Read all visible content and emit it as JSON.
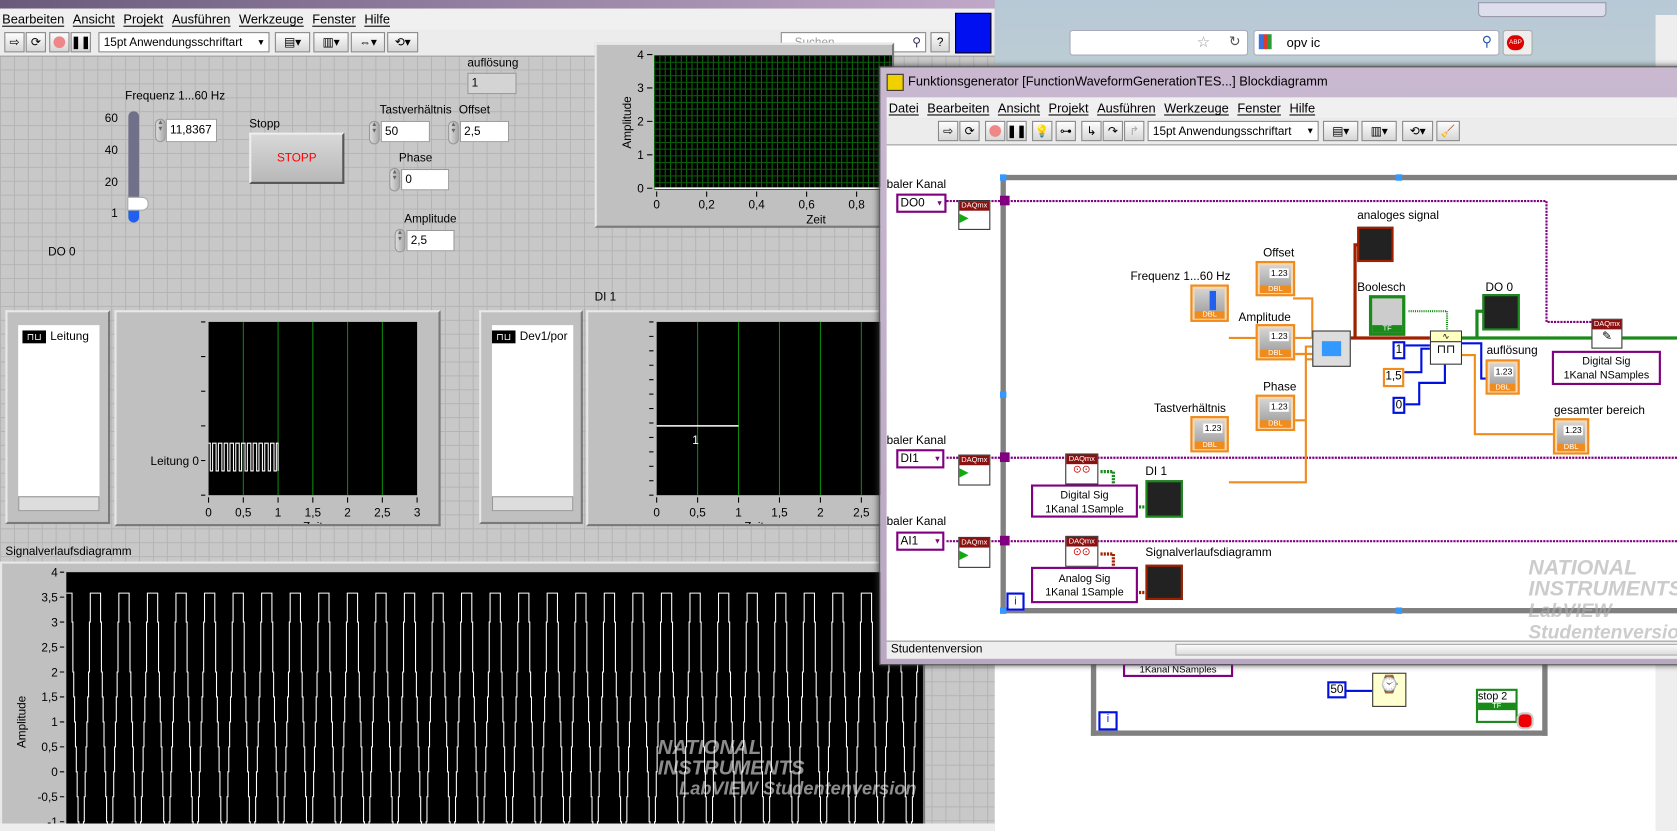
{
  "front_panel": {
    "menu": [
      "Bearbeiten",
      "Ansicht",
      "Projekt",
      "Ausführen",
      "Werkzeuge",
      "Fenster",
      "Hilfe"
    ],
    "font_select": "15pt Anwendungsschriftart",
    "search_placeholder": "Suchen",
    "help_glyph": "?",
    "aufloesung": {
      "label": "auflösung",
      "value": "1"
    },
    "frequenz": {
      "label": "Frequenz 1...60 Hz",
      "value": "11,8367",
      "scale": [
        "60",
        "40",
        "20",
        "1"
      ],
      "slider_value": 11.8367,
      "min": 1,
      "max": 60
    },
    "stopp": {
      "label": "Stopp",
      "button": "STOPP"
    },
    "tastverhaeltnis": {
      "label": "Tastverhältnis",
      "value": "50"
    },
    "offset": {
      "label": "Offset",
      "value": "2,5"
    },
    "phase": {
      "label": "Phase",
      "value": "0"
    },
    "amplitude": {
      "label": "Amplitude",
      "value": "2,5"
    },
    "do0_label": "DO 0",
    "do0_legend": "Leitung",
    "di1_label": "DI 1",
    "di1_legend": "Dev1/por",
    "waveform_label": "Signalverlaufsdiagramm"
  },
  "chart_data": [
    {
      "name": "analoges signal",
      "type": "line",
      "xlabel": "Zeit",
      "ylabel": "Amplitude",
      "xticks": [
        "0",
        "0,2",
        "0,4",
        "0,6",
        "0,8"
      ],
      "yticks": [
        "0",
        "1",
        "2",
        "3",
        "4"
      ],
      "xlim": [
        0,
        0.95
      ],
      "ylim": [
        0,
        4
      ],
      "grid": true
    },
    {
      "name": "DO 0",
      "type": "line",
      "xlabel": "Zeit",
      "ylabel": "",
      "xticks": [
        "0",
        "0,5",
        "1",
        "1,5",
        "2",
        "2,5",
        "3"
      ],
      "xlim": [
        0,
        3
      ],
      "ytick_label": "Leitung 0",
      "pulse_until": 1,
      "pulses": 12
    },
    {
      "name": "DI 1",
      "type": "line",
      "xlabel": "Zeit",
      "xticks": [
        "0",
        "0,5",
        "1",
        "1,5",
        "2",
        "2,5"
      ],
      "xlim": [
        0,
        2.9
      ],
      "segment": {
        "x": [
          0,
          1
        ],
        "label": "1"
      }
    },
    {
      "name": "Signalverlaufsdiagramm",
      "type": "line",
      "ylabel": "Amplitude",
      "yticks": [
        "4",
        "3,5",
        "3",
        "2,5",
        "2",
        "1,5",
        "1",
        "0,5",
        "0",
        "-0,5",
        "-1"
      ],
      "ylim": [
        -1.25,
        4
      ],
      "high": 3.58,
      "low": -1.3,
      "cycles": 30
    }
  ],
  "block_diagram": {
    "title": "Funktionsgenerator [FunctionWaveformGenerationTES...] Blockdiagramm",
    "menu": [
      "Datei",
      "Bearbeiten",
      "Ansicht",
      "Projekt",
      "Ausführen",
      "Werkzeuge",
      "Fenster",
      "Hilfe"
    ],
    "font_select": "15pt Anwendungsschriftart",
    "channel_label": "baler Kanal",
    "do0_const": "DO0",
    "di1_const": "DI1",
    "ai1_const": "AI1",
    "daqmx": "DAQmx",
    "num_glyph": "1.23",
    "dbl": "DBL",
    "tf": "TF",
    "labels": {
      "analoges": "analoges signal",
      "offset": "Offset",
      "frequenz": "Frequenz 1...60 Hz",
      "amplitude": "Amplitude",
      "boolesch": "Boolesch",
      "do0": "DO 0",
      "aufloesung": "auflösung",
      "phase": "Phase",
      "tastverhaeltnis": "Tastverhältnis",
      "gesamter": "gesamter bereich",
      "di1": "DI 1",
      "signalverlauf": "Signalverlaufsdiagramm"
    },
    "const_1": "1",
    "const_15": "1,5",
    "const_0": "0",
    "write_ring": [
      "Digital Sig",
      "1Kanal NSamples"
    ],
    "read_digital_ring": [
      "Digital Sig",
      "1Kanal 1Sample"
    ],
    "read_analog_ring": [
      "Analog Sig",
      "1Kanal 1Sample"
    ],
    "iteration": "i",
    "status": "Studentenversion",
    "watermark": [
      "NATIONAL",
      "INSTRUMENTS",
      "LabVIEW Studentenversion"
    ]
  },
  "background_diagram": {
    "ring": "1Kanal NSamples",
    "const_50": "50",
    "stop_label": "stop 2",
    "tf": "TF",
    "iteration": "i"
  },
  "browser": {
    "search_value": "opv ic",
    "abp": "ABP"
  },
  "watermark": [
    "NATIONAL",
    "INSTRUMENTS",
    "LabVIEW Studentenversion"
  ]
}
